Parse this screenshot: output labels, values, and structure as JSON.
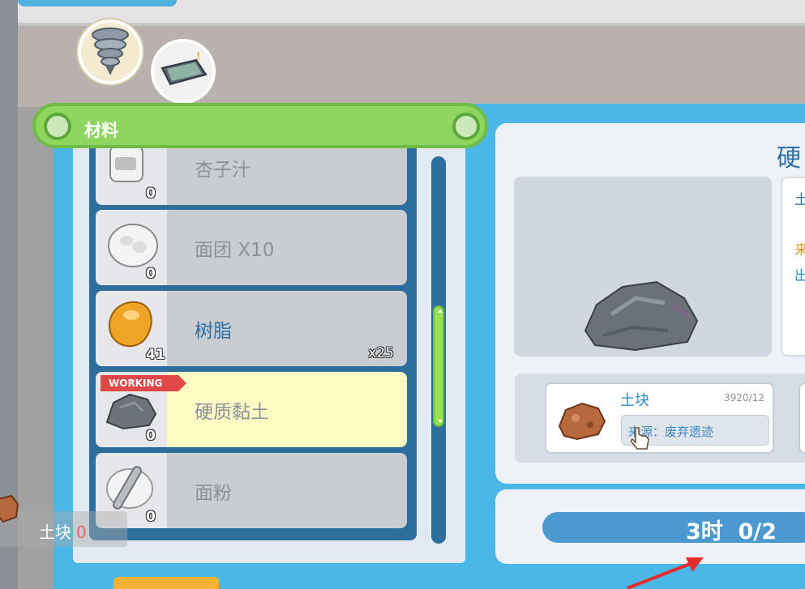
{
  "header": {
    "title": "材料"
  },
  "materials": [
    {
      "name": "杏子汁",
      "owned": "0",
      "amount": "",
      "status": "locked",
      "icon": "juice-jar-icon"
    },
    {
      "name": "面团 X10",
      "owned": "0",
      "amount": "",
      "status": "locked",
      "icon": "dough-icon"
    },
    {
      "name": "树脂",
      "owned": "41",
      "amount": "x25",
      "status": "available",
      "icon": "resin-icon"
    },
    {
      "name": "硬质黏土",
      "owned": "0",
      "amount": "",
      "status": "selected",
      "badge": "WORKING",
      "icon": "hard-clay-icon"
    },
    {
      "name": "面粉",
      "owned": "0",
      "amount": "",
      "status": "locked",
      "icon": "flour-icon"
    }
  ],
  "detail": {
    "title": "硬",
    "info_lines": [
      "土",
      "来",
      "出"
    ],
    "requirement": {
      "name": "土块",
      "count": "3920/12",
      "source": "来源：废弃遗迹",
      "icon": "dirt-clump-icon"
    },
    "time": "3时",
    "progress": "0/2"
  },
  "tooltip": {
    "name": "土块",
    "count": "0"
  },
  "colors": {
    "panel_blue": "#4bb7e7",
    "header_green": "#8ed65f",
    "selected_yellow": "#fdfbc3",
    "working_red": "#e04848",
    "time_bar": "#4c99cf",
    "arrow_red": "#e52b2b"
  }
}
